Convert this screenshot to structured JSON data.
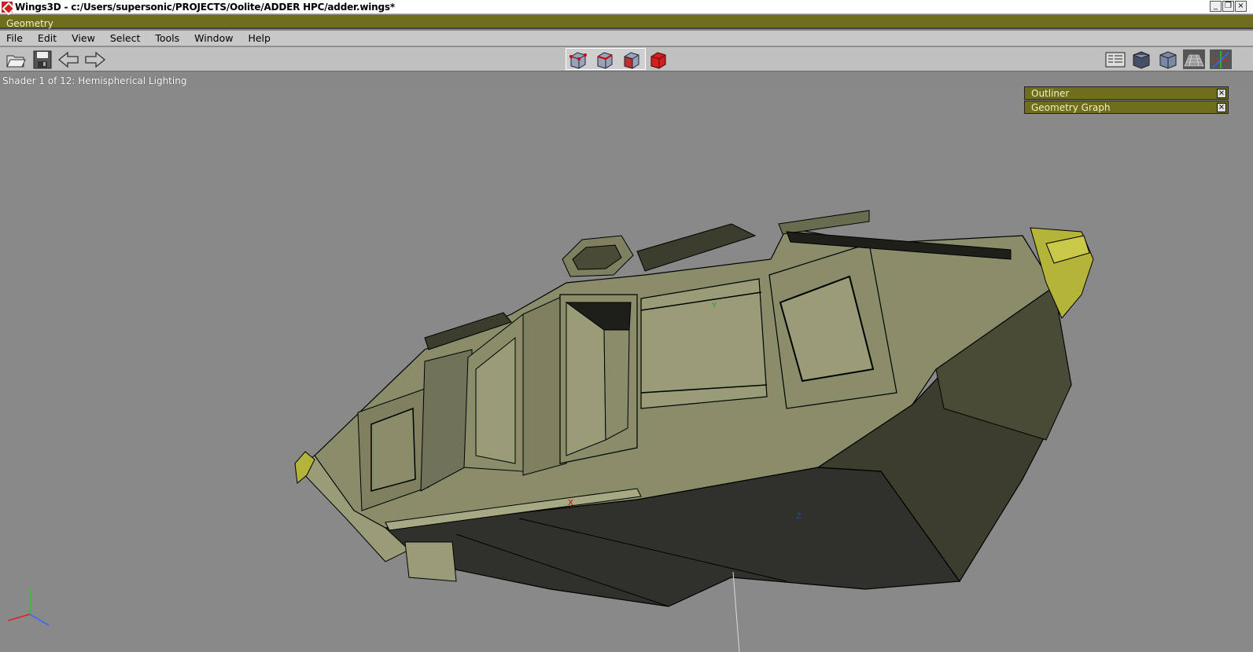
{
  "window": {
    "title": "Wings3D - c:/Users/supersonic/PROJECTS/Oolite/ADDER HPC/adder.wings*",
    "controls": [
      "_",
      "❐",
      "×"
    ]
  },
  "geometry_bar": {
    "label": "Geometry"
  },
  "menu": {
    "items": [
      "File",
      "Edit",
      "View",
      "Select",
      "Tools",
      "Window",
      "Help"
    ]
  },
  "toolbar": {
    "left": [
      "open-icon",
      "save-icon",
      "undo-icon",
      "redo-icon"
    ],
    "selection_modes": [
      "vertex-mode",
      "edge-mode",
      "face-mode",
      "body-mode"
    ],
    "right": [
      "groundplane-icon",
      "smooth-shade-icon",
      "flat-shade-icon",
      "wireframe-icon",
      "axes-icon"
    ]
  },
  "status": {
    "text": "Shader 1 of 12: Hemispherical Lighting"
  },
  "panels": {
    "outliner": "Outliner",
    "geometry_graph": "Geometry Graph"
  },
  "axes": {
    "x_label": "X",
    "y_label": "Y",
    "z_label": "Z"
  },
  "colors": {
    "model": "#8a8c6a",
    "model_dark": "#3c3d2c",
    "accent_yellow": "#b5b43a",
    "title_bar": "#6e6e1e"
  }
}
